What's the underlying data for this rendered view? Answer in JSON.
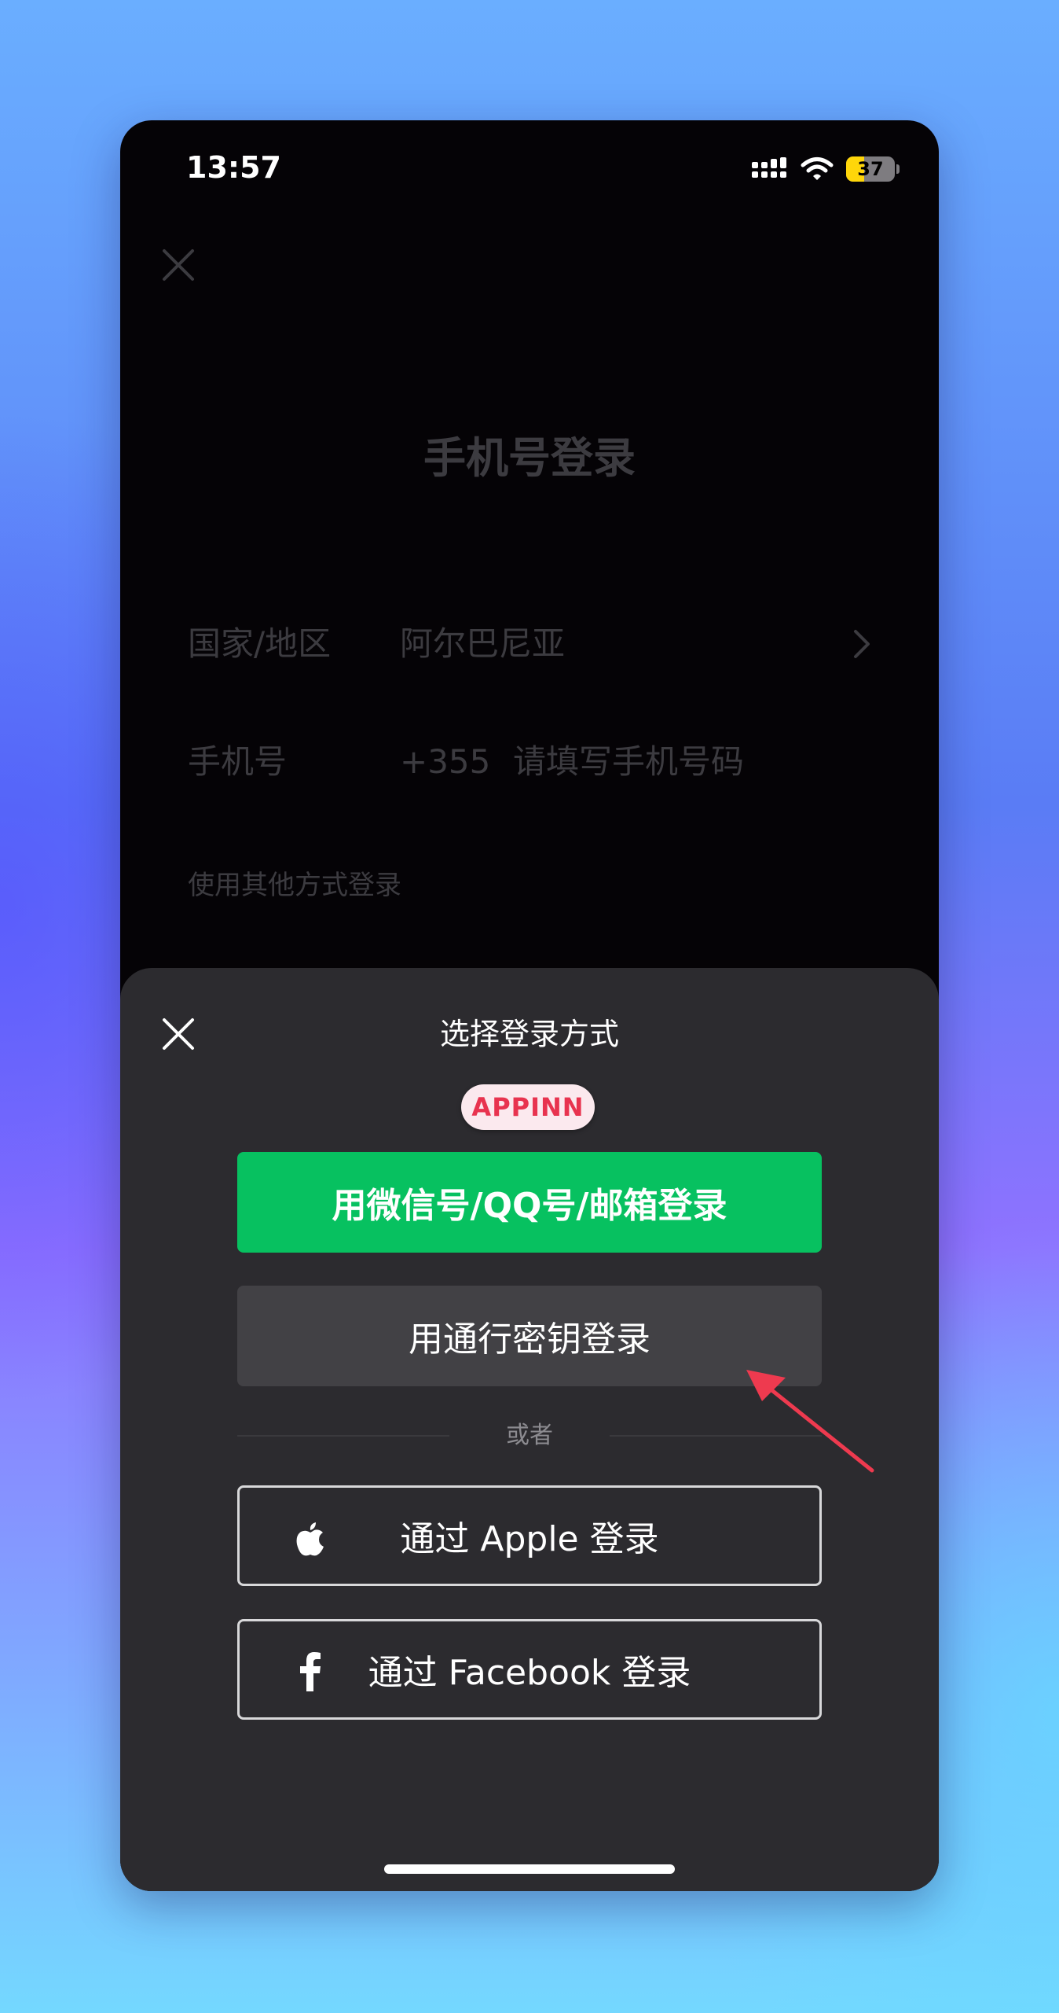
{
  "status_bar": {
    "time": "13:57",
    "battery_level": "37",
    "battery_percent": 37,
    "battery_fill_color": "#ffd60a"
  },
  "background_screen": {
    "close_icon": "close-icon",
    "title": "手机号登录",
    "country_label": "国家/地区",
    "country_value": "阿尔巴尼亚",
    "phone_label": "手机号",
    "phone_code": "+355",
    "phone_placeholder": "请填写手机号码",
    "other_methods_link": "使用其他方式登录"
  },
  "sheet": {
    "title": "选择登录方式",
    "badge": "APPINN",
    "wechat_button": "用微信号/QQ号/邮箱登录",
    "passkey_button": "用通行密钥登录",
    "divider_text": "或者",
    "apple_button": "通过 Apple 登录",
    "facebook_button": "通过 Facebook 登录"
  },
  "colors": {
    "wechat_green": "#07c160",
    "badge_red": "#e8334f",
    "sheet_bg": "#2c2b2f",
    "annotation_arrow": "#ee3a4f"
  }
}
